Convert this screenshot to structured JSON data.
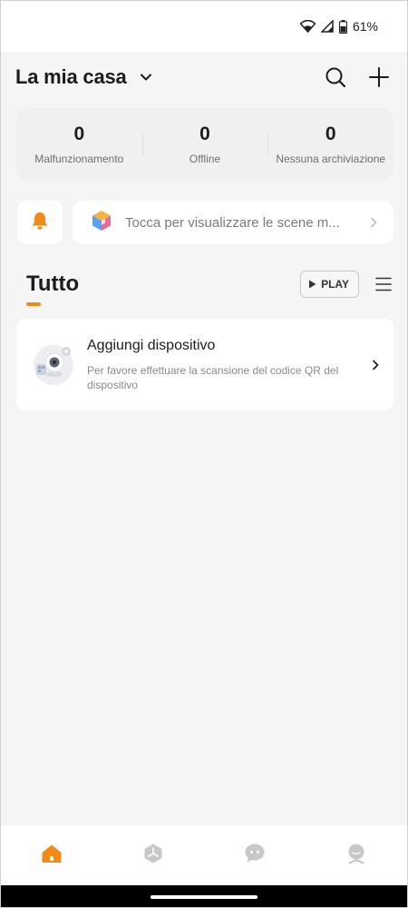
{
  "status_bar": {
    "battery_text": "61%",
    "icons": [
      "wifi-icon",
      "signal-icon",
      "battery-icon"
    ]
  },
  "header": {
    "home_name": "La mia casa",
    "actions": [
      "search-icon",
      "add-icon"
    ]
  },
  "stats": [
    {
      "value": "0",
      "label": "Malfunzionamento"
    },
    {
      "value": "0",
      "label": "Offline"
    },
    {
      "value": "0",
      "label": "Nessuna archiviazione"
    }
  ],
  "scenes": {
    "text": "Tocca per visualizzare le scene m..."
  },
  "section": {
    "title": "Tutto",
    "play_label": "PLAY"
  },
  "device_card": {
    "title": "Aggiungi dispositivo",
    "subtitle": "Per favore effettuare la scansione del codice QR del dispositivo"
  },
  "tabs": [
    {
      "icon": "home-icon",
      "active": true
    },
    {
      "icon": "scenes-icon",
      "active": false
    },
    {
      "icon": "chat-icon",
      "active": false
    },
    {
      "icon": "profile-icon",
      "active": false
    }
  ],
  "colors": {
    "accent": "#f18a16",
    "background": "#f5f5f5",
    "card": "#ffffff",
    "inactive_icon": "#c8c8c8"
  }
}
